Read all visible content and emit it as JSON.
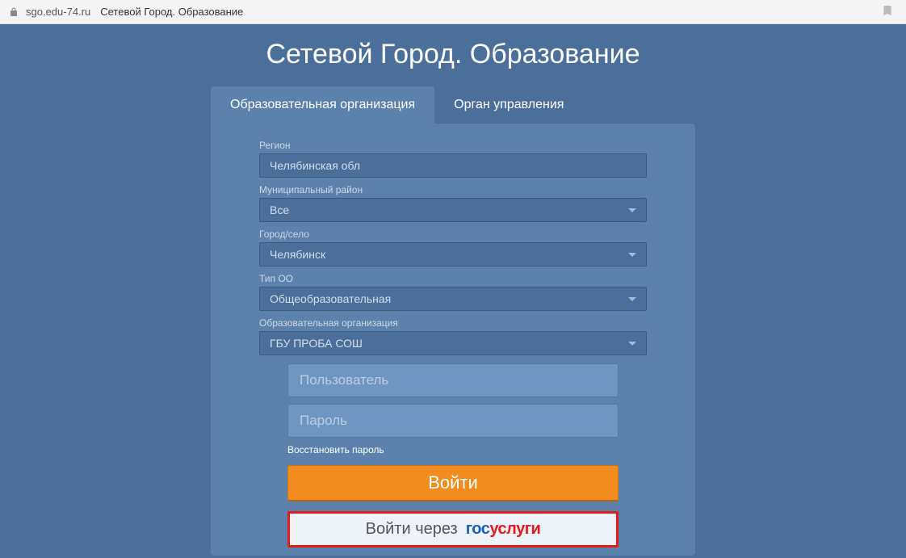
{
  "browser": {
    "url": "sgo.edu-74.ru",
    "title": "Сетевой Город. Образование"
  },
  "header": {
    "title": "Сетевой Город. Образование"
  },
  "tabs": {
    "active": "Образовательная организация",
    "inactive": "Орган управления"
  },
  "form": {
    "region": {
      "label": "Регион",
      "value": "Челябинская обл"
    },
    "district": {
      "label": "Муниципальный район",
      "value": "Все"
    },
    "city": {
      "label": "Город/село",
      "value": "Челябинск"
    },
    "type": {
      "label": "Тип ОО",
      "value": "Общеобразовательная"
    },
    "org": {
      "label": "Образовательная организация",
      "value": "ГБУ ПРОБА СОШ"
    },
    "username_placeholder": "Пользователь",
    "password_placeholder": "Пароль",
    "forgot_link": "Восстановить пароль",
    "login_button": "Войти",
    "gosuslugi_prefix": "Войти через",
    "gosuslugi_blue": "гос",
    "gosuslugi_red": "услуги"
  }
}
